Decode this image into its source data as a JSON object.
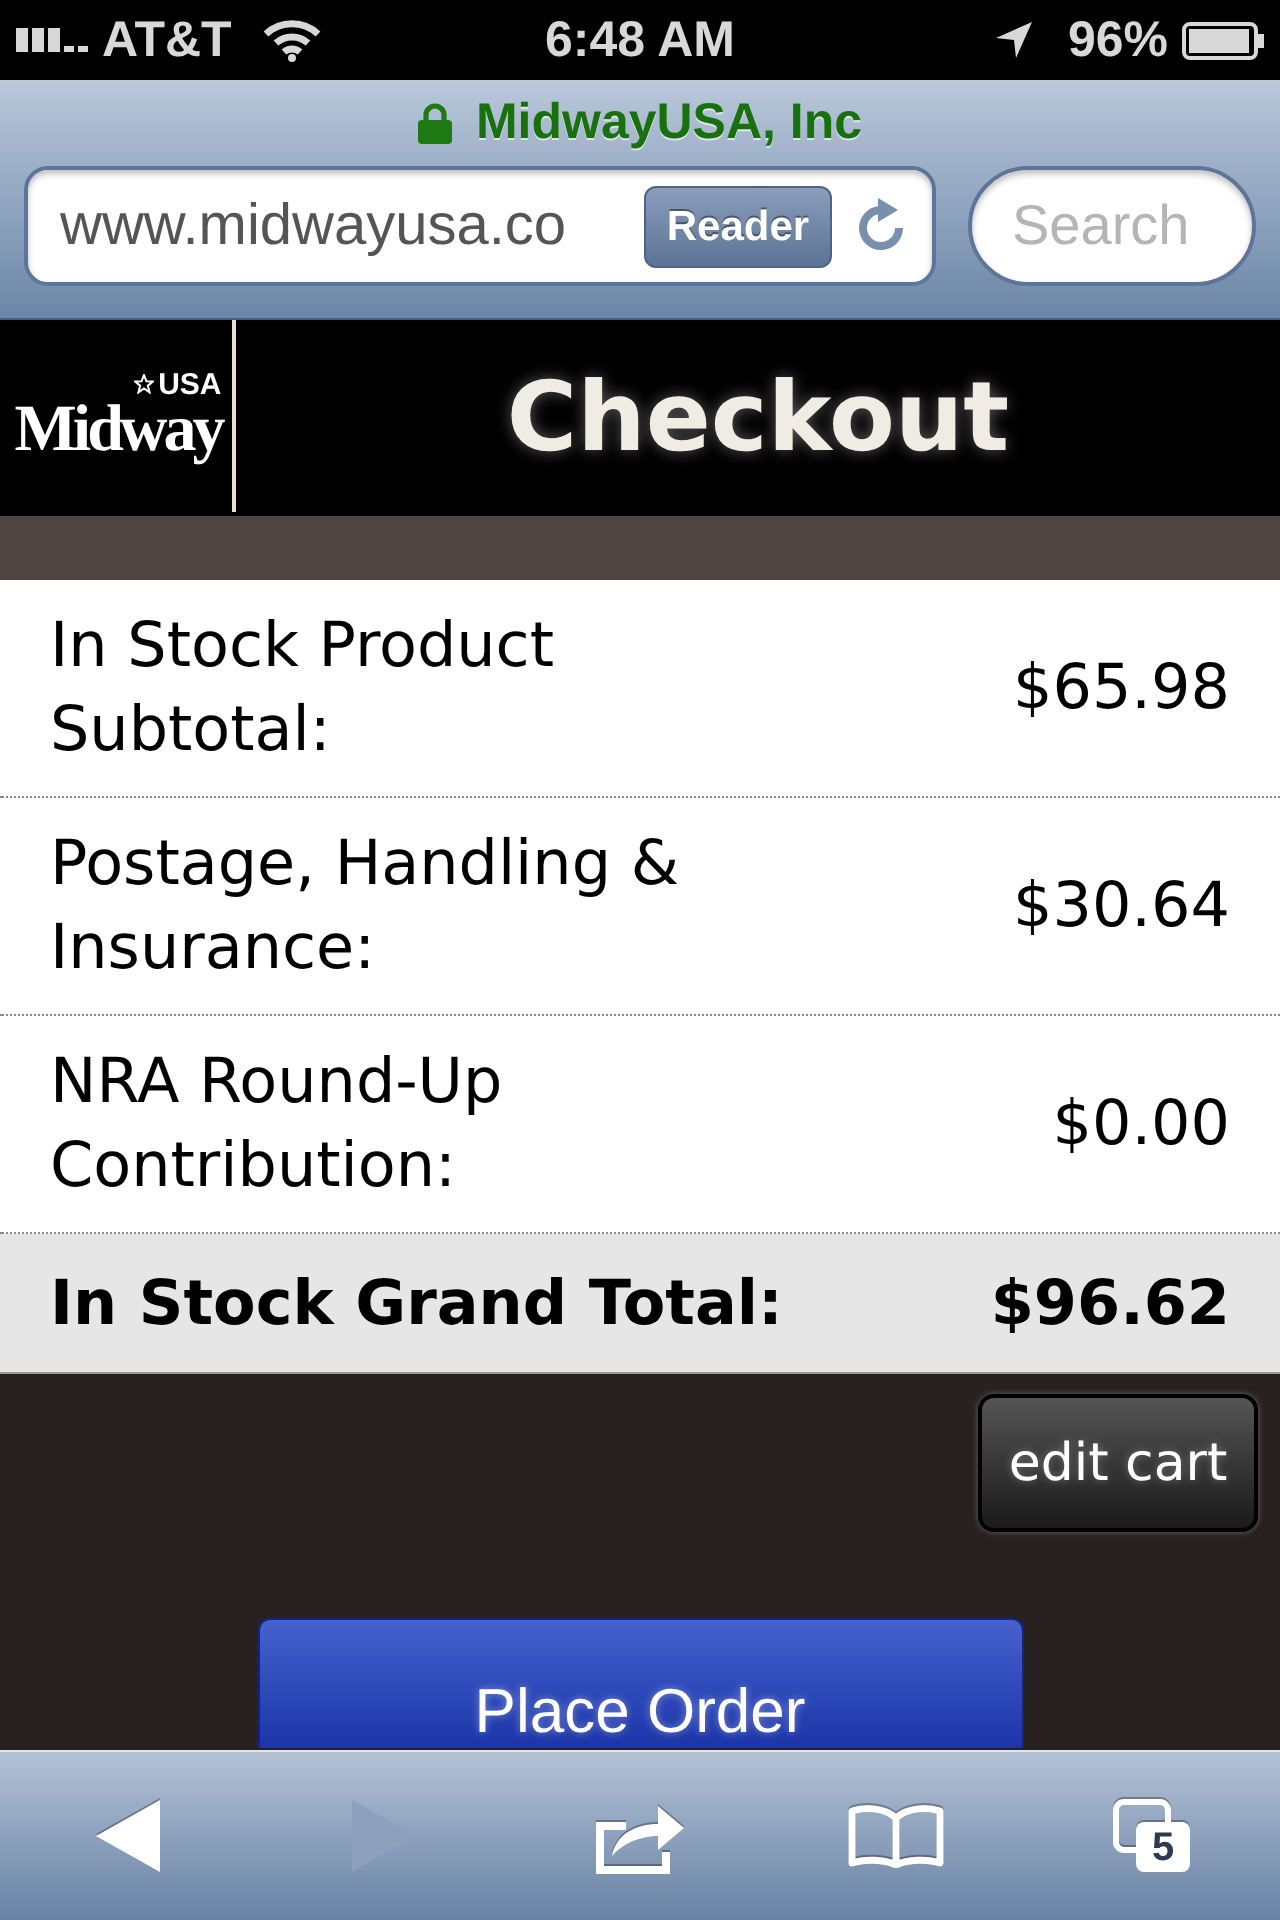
{
  "status_bar": {
    "carrier": "AT&T",
    "time": "6:48 AM",
    "battery": "96%"
  },
  "browser": {
    "site_title": "MidwayUSA, Inc",
    "secure": true,
    "url": "www.midwayusa.co",
    "reader_button": "Reader",
    "search": {
      "placeholder": "Search"
    }
  },
  "header": {
    "logo": {
      "tag": "USA",
      "wordmark": "Midway"
    },
    "title": "Checkout"
  },
  "summary": {
    "rows": [
      {
        "kind": "line",
        "label": "In Stock Product Subtotal:",
        "value": "$65.98"
      },
      {
        "kind": "line",
        "label": "Postage, Handling & Insurance:",
        "value": "$30.64"
      },
      {
        "kind": "line",
        "label": "NRA Round-Up Contribution:",
        "value": "$0.00"
      },
      {
        "kind": "total",
        "label": "In Stock Grand Total:",
        "value": "$96.62"
      }
    ]
  },
  "actions": {
    "edit_cart": "edit cart",
    "place_order": "Place Order"
  },
  "toolbar": [
    {
      "kind": "back",
      "disabled": false
    },
    {
      "kind": "forward",
      "disabled": true
    },
    {
      "kind": "share",
      "disabled": false
    },
    {
      "kind": "bookmarks",
      "disabled": false
    },
    {
      "kind": "tabs",
      "disabled": false,
      "count": "5"
    }
  ]
}
